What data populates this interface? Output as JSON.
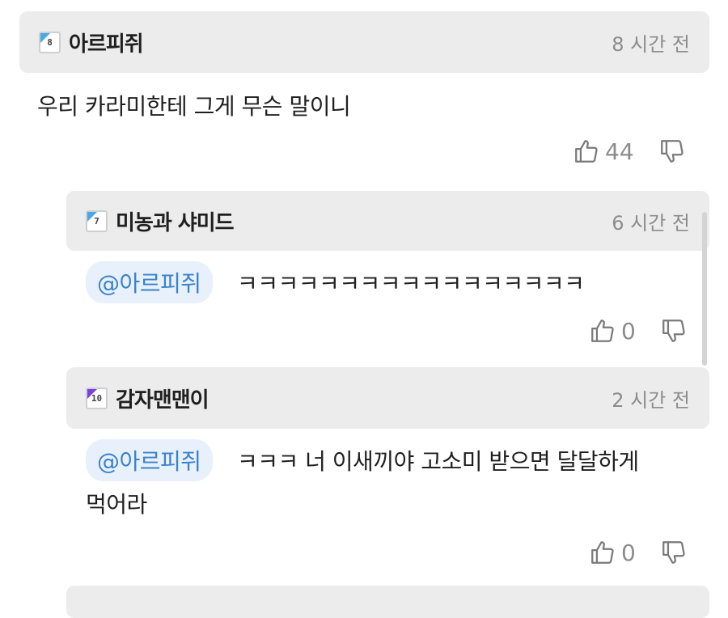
{
  "comments": [
    {
      "user": "아르피쥐",
      "level": "8",
      "time": "8 시간 전",
      "text": "우리 카라미한테 그게 무슨 말이니",
      "likes": "44"
    },
    {
      "user": "미농과 샤미드",
      "level": "7",
      "time": "6 시간 전",
      "mention": "@아르피쥐",
      "text": "ㅋㅋㅋㅋㅋㅋㅋㅋㅋㅋㅋㅋㅋㅋㅋㅋㅋ",
      "likes": "0"
    },
    {
      "user": "감자맨맨이",
      "level": "10",
      "time": "2 시간 전",
      "mention": "@아르피쥐",
      "text_line1": "ㅋㅋㅋ 너 이새끼야 고소미 받으면 달달하게",
      "text_line2": "먹어라",
      "likes": "0"
    }
  ],
  "icons": {
    "like": "thumbs-up-icon",
    "dislike": "thumbs-down-icon",
    "level": "level-badge-icon"
  },
  "colors": {
    "header_bg": "#ececec",
    "mention_bg": "#e8f1fb",
    "mention_text": "#3a82cc",
    "level_blue": "#4aa7e8",
    "level_purple": "#7a3fe0"
  }
}
